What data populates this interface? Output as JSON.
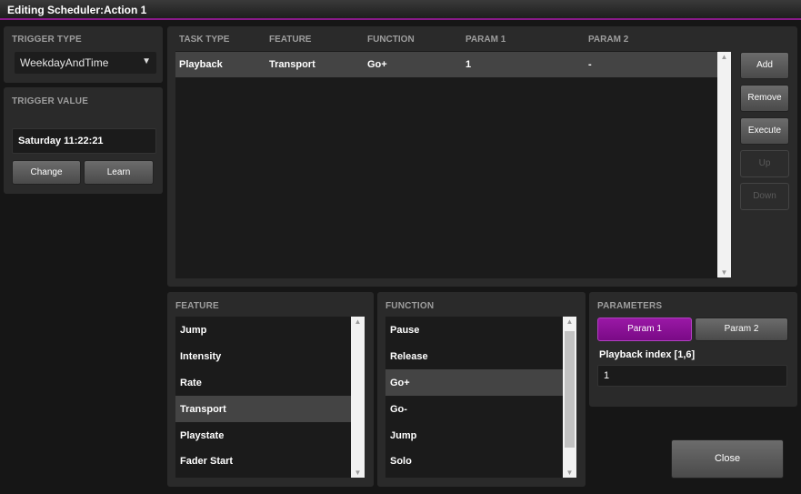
{
  "window": {
    "title": "Editing Scheduler:Action 1"
  },
  "trigger_type": {
    "header": "TRIGGER TYPE",
    "value": "WeekdayAndTime"
  },
  "trigger_value": {
    "header": "TRIGGER VALUE",
    "value": "Saturday 11:22:21",
    "change_label": "Change",
    "learn_label": "Learn"
  },
  "tasks": {
    "columns": [
      "TASK TYPE",
      "FEATURE",
      "FUNCTION",
      "PARAM 1",
      "PARAM 2"
    ],
    "rows": [
      {
        "task_type": "Playback",
        "feature": "Transport",
        "function": "Go+",
        "param1": "1",
        "param2": "-"
      }
    ]
  },
  "actions": {
    "add": "Add",
    "remove": "Remove",
    "execute": "Execute",
    "up": "Up",
    "down": "Down"
  },
  "feature_list": {
    "header": "FEATURE",
    "items": [
      "Jump",
      "Intensity",
      "Rate",
      "Transport",
      "Playstate",
      "Fader Start"
    ],
    "selected": "Transport"
  },
  "function_list": {
    "header": "FUNCTION",
    "items": [
      "Pause",
      "Release",
      "Go+",
      "Go-",
      "Jump",
      "Solo"
    ],
    "selected": "Go+"
  },
  "parameters": {
    "header": "PARAMETERS",
    "param1_label": "Param 1",
    "param2_label": "Param 2",
    "field_label": "Playback index [1,6]",
    "field_value": "1"
  },
  "close_label": "Close",
  "colors": {
    "accent_purple": "#8a1a8a",
    "panel": "#2a2a2a",
    "selected_row": "#444444"
  }
}
